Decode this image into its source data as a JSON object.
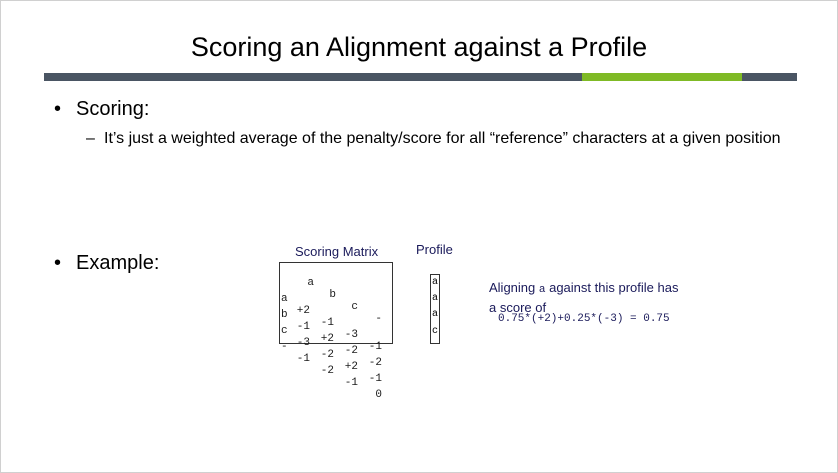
{
  "slide": {
    "title": "Scoring an Alignment against a Profile",
    "bullets": [
      {
        "text": "Scoring:",
        "sub": "It’s just a weighted average of the penalty/score for all “reference” characters at a given position"
      },
      {
        "text": "Example:"
      }
    ],
    "colors": {
      "bar_dark": "#4a5563",
      "bar_accent": "#7fba25",
      "caption_blue": "#1a1a5a"
    }
  },
  "example": {
    "matrix_title": "Scoring Matrix",
    "profile_title": "Profile",
    "matrix": {
      "col_headers": [
        "a",
        "b",
        "c",
        "-"
      ],
      "rows": [
        {
          "label": "a",
          "cells": [
            "+2",
            "-1",
            "-3",
            "-1"
          ]
        },
        {
          "label": "b",
          "cells": [
            "-1",
            "+2",
            "-2",
            "-2"
          ]
        },
        {
          "label": "c",
          "cells": [
            "-3",
            "-2",
            "+2",
            "-1"
          ]
        },
        {
          "label": "-",
          "cells": [
            "-1",
            "-2",
            "-1",
            "0"
          ]
        }
      ]
    },
    "profile": [
      "a",
      "a",
      "a",
      "c"
    ],
    "description_line1_pre": "Aligning ",
    "description_char": "a",
    "description_line1_post": " against this profile has",
    "description_line2": "a score of",
    "formula": "0.75*(+2)+0.25*(-3) = 0.75"
  }
}
